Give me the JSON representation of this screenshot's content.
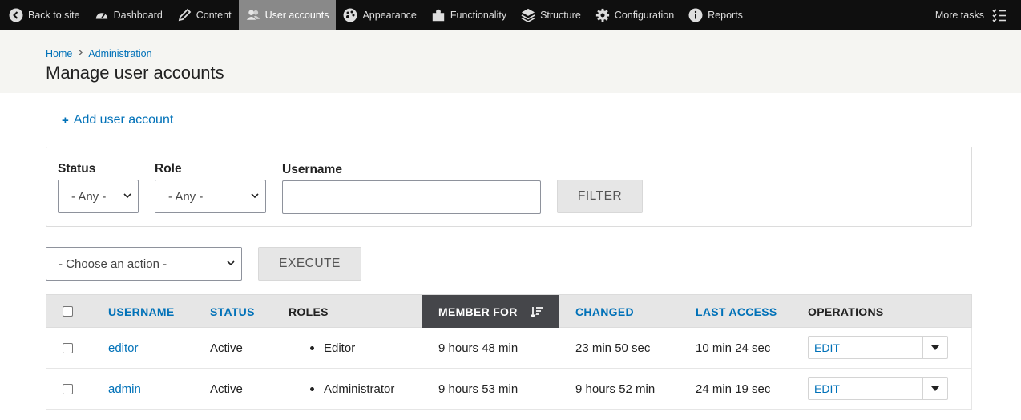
{
  "toolbar": {
    "items": [
      {
        "label": "Back to site",
        "icon": "back-arrow-icon"
      },
      {
        "label": "Dashboard",
        "icon": "dashboard-icon"
      },
      {
        "label": "Content",
        "icon": "pencil-icon"
      },
      {
        "label": "User accounts",
        "icon": "users-icon"
      },
      {
        "label": "Appearance",
        "icon": "palette-icon"
      },
      {
        "label": "Functionality",
        "icon": "puzzle-icon"
      },
      {
        "label": "Structure",
        "icon": "layers-icon"
      },
      {
        "label": "Configuration",
        "icon": "gear-icon"
      },
      {
        "label": "Reports",
        "icon": "info-icon"
      }
    ],
    "active_index": 3,
    "more_tasks": "More tasks"
  },
  "breadcrumb": [
    "Home",
    "Administration"
  ],
  "page_title": "Manage user accounts",
  "add_user": "Add user account",
  "filter": {
    "status_label": "Status",
    "status_value": "- Any -",
    "role_label": "Role",
    "role_value": "- Any -",
    "username_label": "Username",
    "username_value": "",
    "filter_button": "FILTER"
  },
  "bulk": {
    "action_value": "- Choose an action -",
    "execute_button": "EXECUTE"
  },
  "table": {
    "headers": {
      "username": "USERNAME",
      "status": "STATUS",
      "roles": "ROLES",
      "member_for": "MEMBER FOR",
      "changed": "CHANGED",
      "last_access": "LAST ACCESS",
      "operations": "OPERATIONS"
    },
    "rows": [
      {
        "username": "editor",
        "status": "Active",
        "role": "Editor",
        "member_for": "9 hours 48 min",
        "changed": "23 min 50 sec",
        "last_access": "10 min 24 sec",
        "op": "EDIT"
      },
      {
        "username": "admin",
        "status": "Active",
        "role": "Administrator",
        "member_for": "9 hours 53 min",
        "changed": "9 hours 52 min",
        "last_access": "24 min 19 sec",
        "op": "EDIT"
      }
    ]
  },
  "colors": {
    "link": "#0071b8",
    "toolbar_bg": "#0f0f0f",
    "active_tab": "#898989",
    "sorted_header": "#45464a"
  }
}
